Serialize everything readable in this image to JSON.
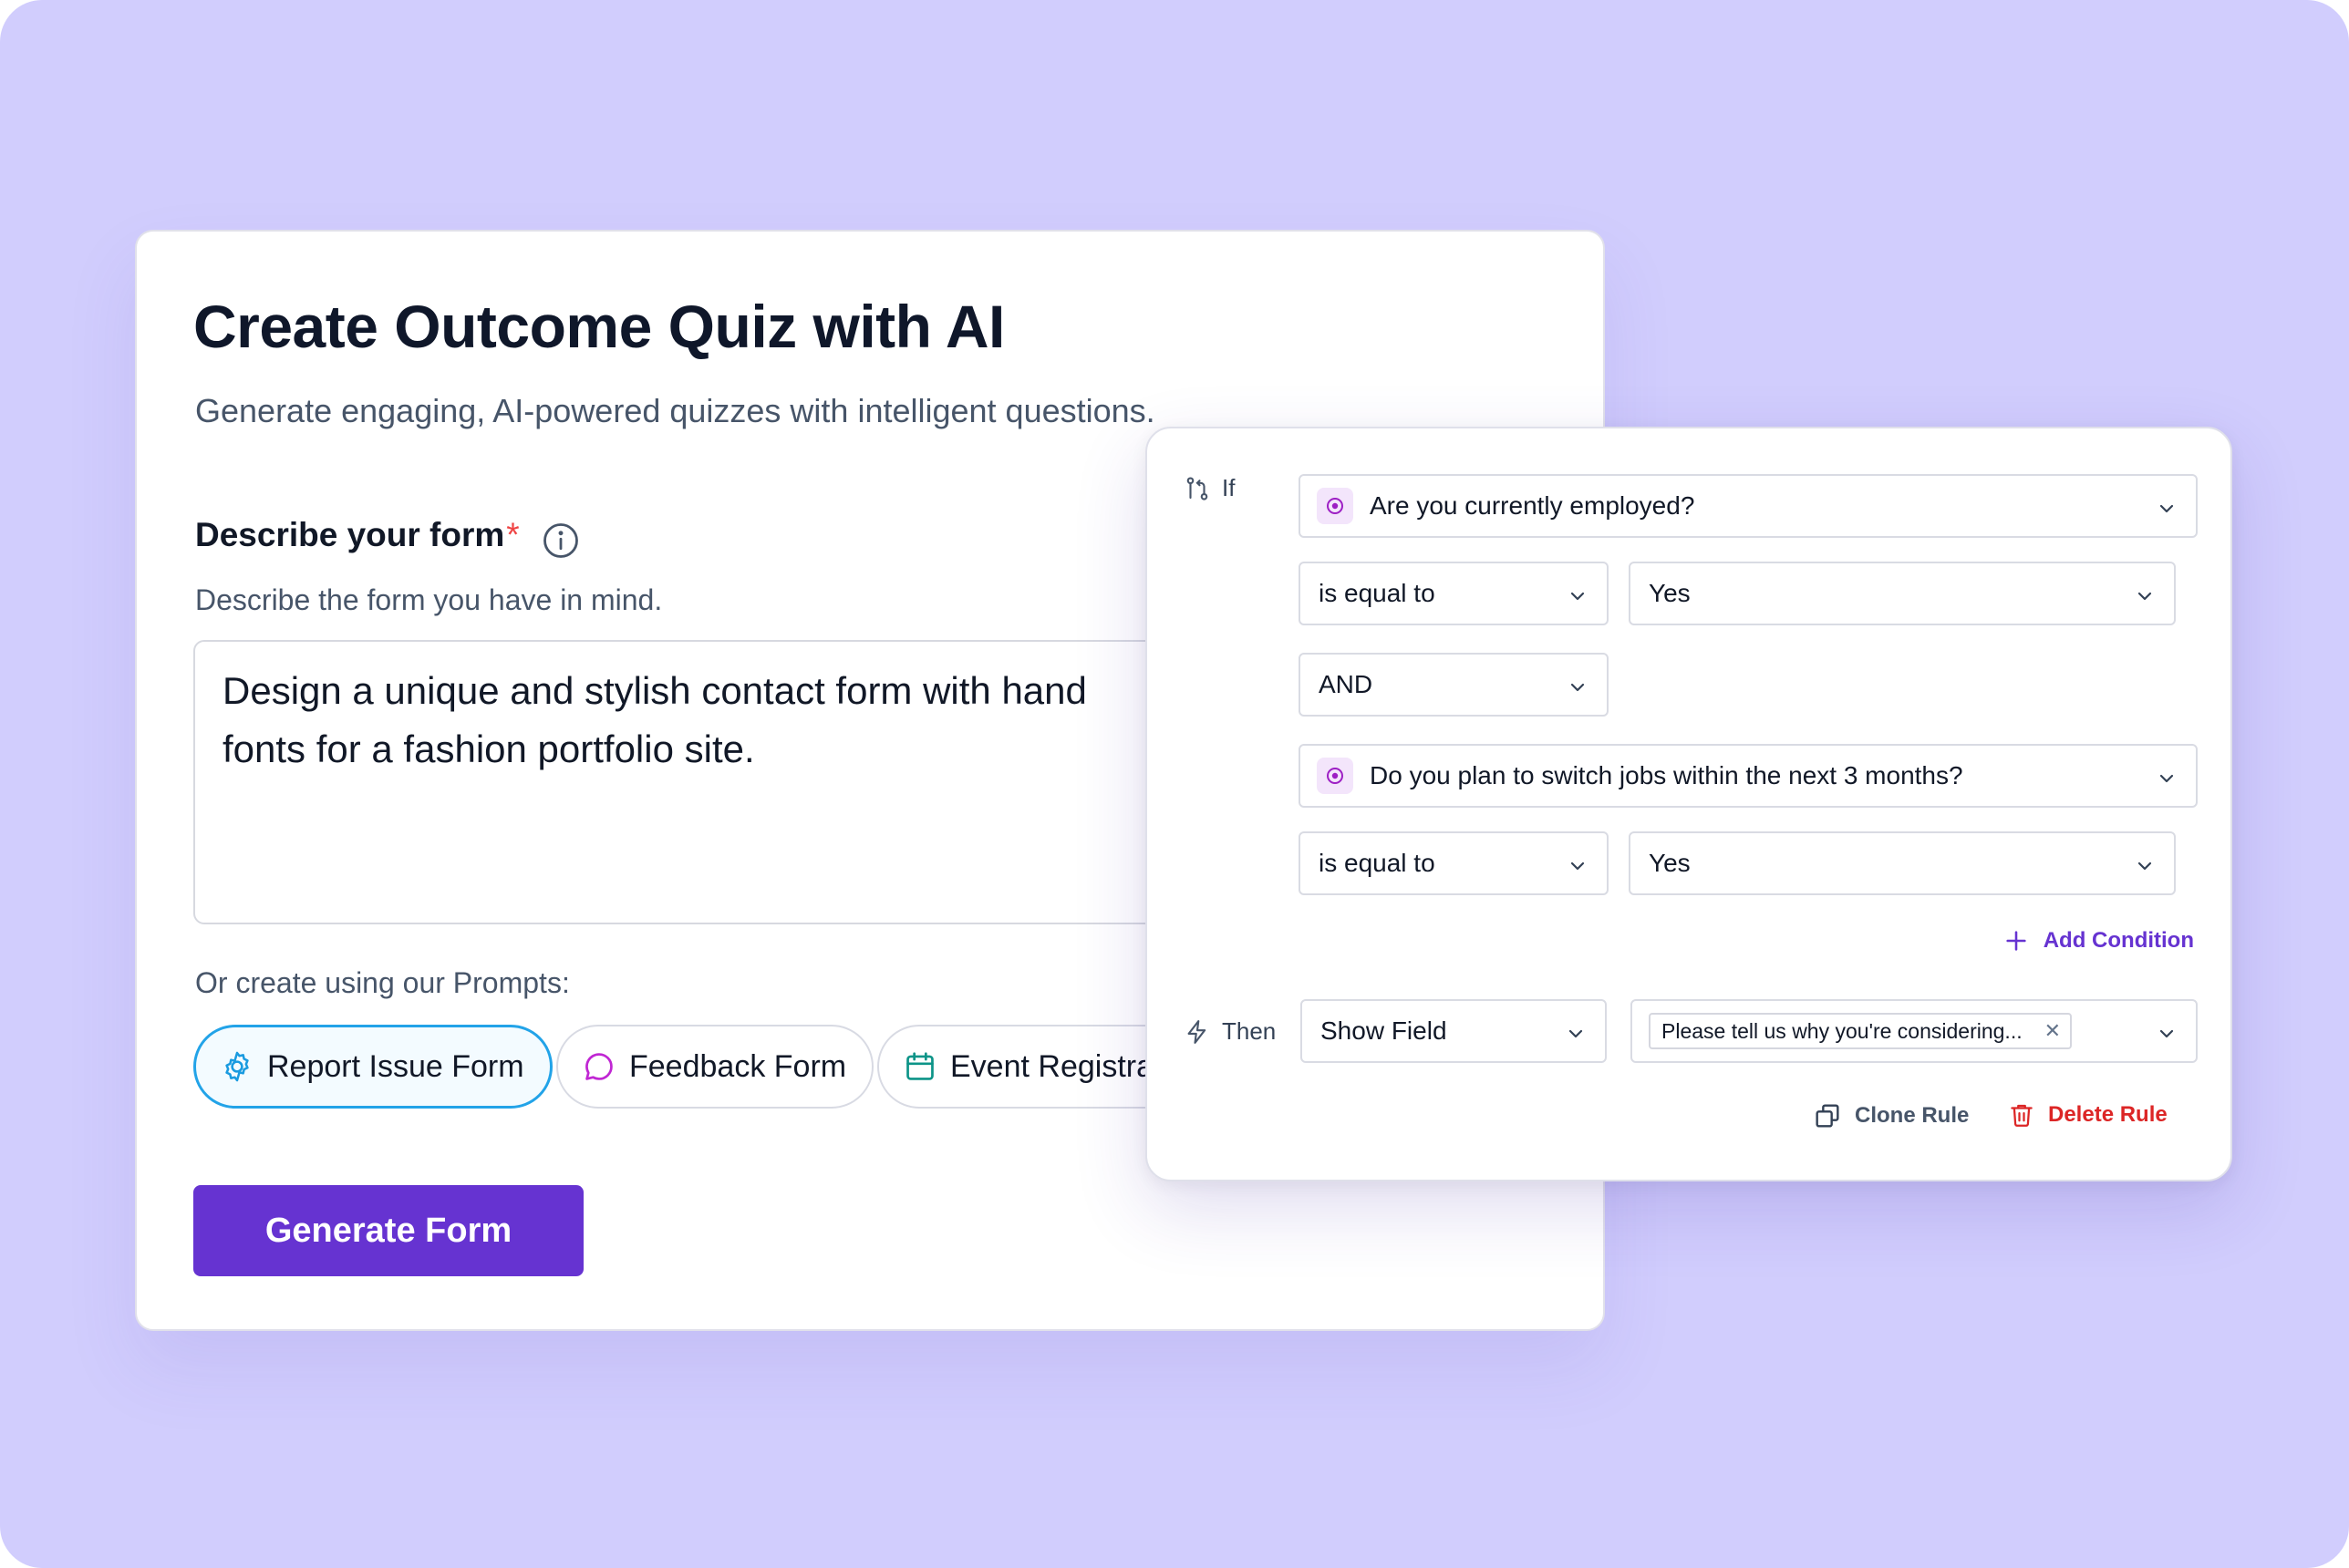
{
  "colors": {
    "background": "#d1cdfd",
    "primary": "#6633d1",
    "danger": "#dc2626",
    "required": "#ef4444",
    "active_chip_border": "#22a3e8"
  },
  "form_card": {
    "title": "Create Outcome Quiz with AI",
    "subtitle": "Generate engaging, AI-powered quizzes with intelligent questions.",
    "field_label": "Describe your form",
    "required_mark": "*",
    "field_help": "Describe the form you have in mind.",
    "description_value": "Design a unique and stylish contact form with hand\nfonts for a fashion portfolio site.",
    "prompts_label": "Or create using our Prompts:",
    "prompts": [
      {
        "label": "Report Issue Form",
        "icon": "gear-icon",
        "active": true
      },
      {
        "label": "Feedback Form",
        "icon": "chat-bubble-icon",
        "active": false
      },
      {
        "label": "Event Registrat",
        "icon": "calendar-icon",
        "active": false
      }
    ],
    "generate_label": "Generate Form"
  },
  "rule_card": {
    "if_label": "If",
    "then_label": "Then",
    "condition1": {
      "question": "Are you currently employed?",
      "operator": "is equal to",
      "value": "Yes"
    },
    "connector": "AND",
    "condition2": {
      "question": "Do you plan to switch jobs within the next 3 months?",
      "operator": "is equal to",
      "value": "Yes"
    },
    "add_condition": "Add Condition",
    "action": "Show Field",
    "target_field": "Please tell us why you're considering...",
    "clone_rule": "Clone Rule",
    "delete_rule": "Delete Rule"
  }
}
